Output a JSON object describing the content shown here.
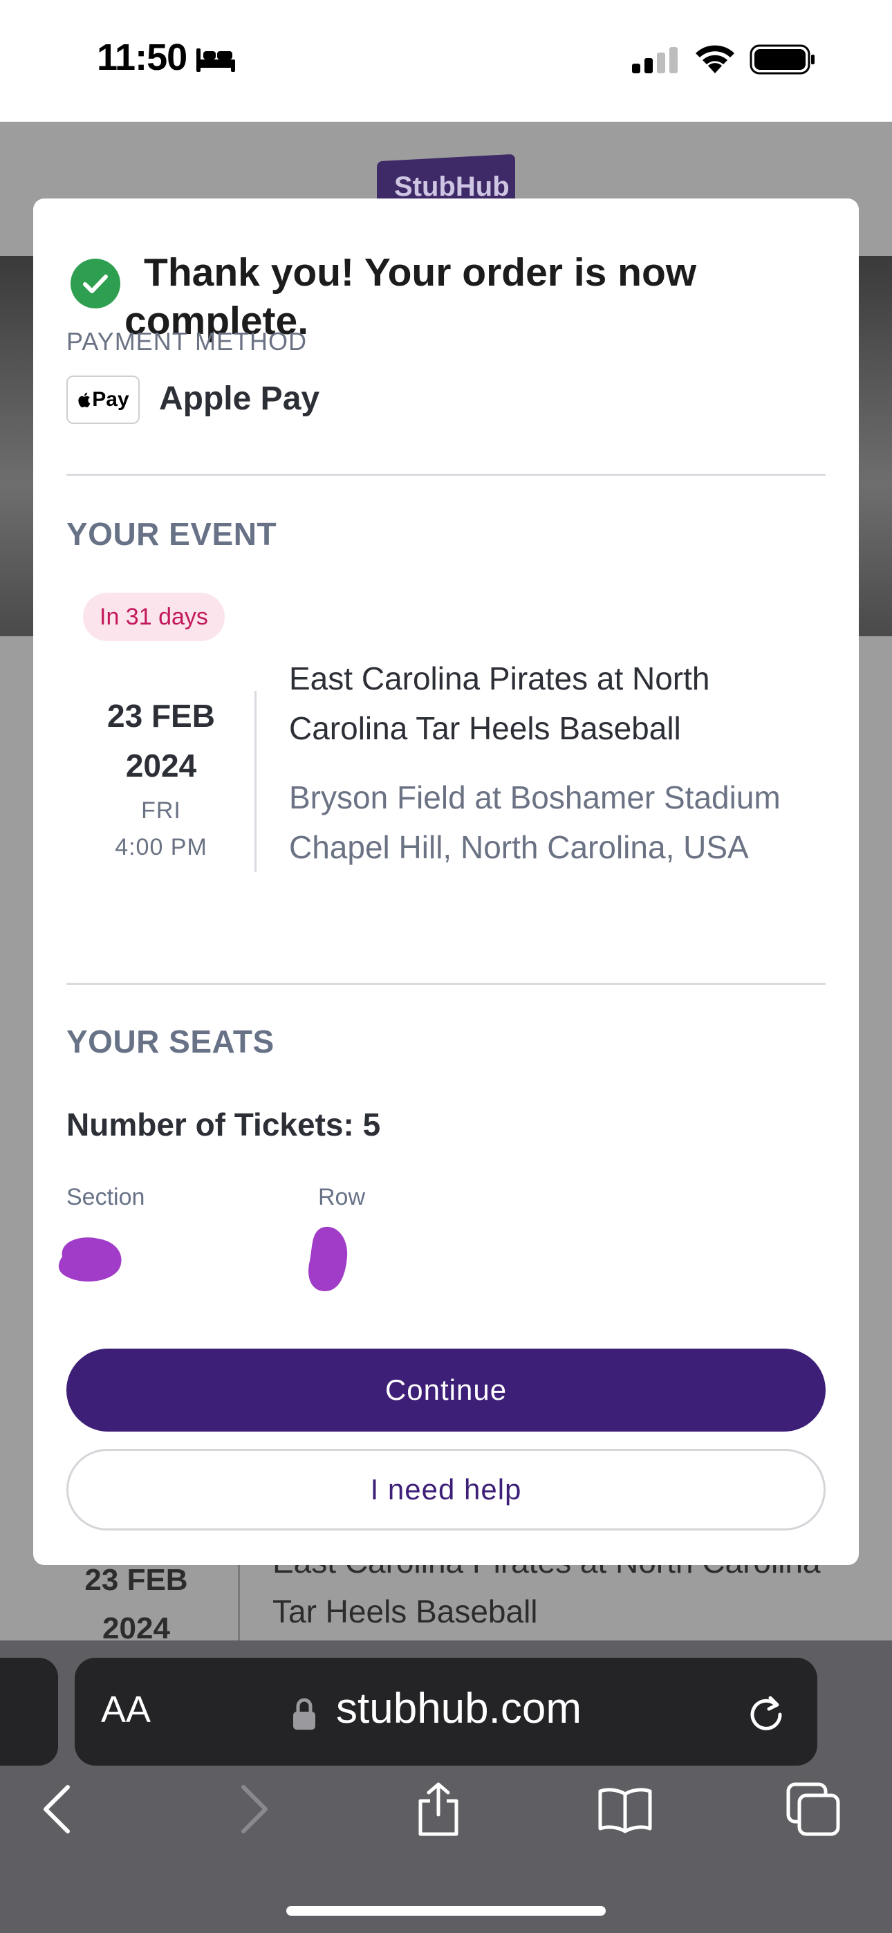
{
  "status_bar": {
    "time": "11:50",
    "icons": [
      "bed-icon",
      "cellular-signal-icon",
      "wifi-icon",
      "battery-icon"
    ]
  },
  "background_page": {
    "logo": "StubHub",
    "date_line1": "23 FEB",
    "date_line2": "2024",
    "event_title": "East Carolina Pirates at North Carolina Tar Heels Baseball"
  },
  "modal": {
    "title": "Thank you! Your order is now complete.",
    "payment": {
      "label": "PAYMENT METHOD",
      "badge": "Pay",
      "value": "Apple Pay"
    },
    "event": {
      "heading": "YOUR EVENT",
      "countdown": "In 31 days",
      "date_day_month": "23 FEB",
      "date_year": "2024",
      "day_of_week": "FRI",
      "time": "4:00 PM",
      "title": "East Carolina Pirates at North Carolina Tar Heels Baseball",
      "venue_line1": "Bryson Field at Boshamer Stadium",
      "venue_line2": "Chapel Hill, North Carolina, USA"
    },
    "seats": {
      "heading": "YOUR SEATS",
      "tickets": "Number of Tickets: 5",
      "section_label": "Section",
      "row_label": "Row"
    },
    "buttons": {
      "continue": "Continue",
      "help": "I need help"
    }
  },
  "safari": {
    "text_size_label": "AA",
    "url": "stubhub.com",
    "nav_icons": [
      "back-icon",
      "forward-icon",
      "share-icon",
      "bookmarks-icon",
      "tabs-icon"
    ]
  },
  "colors": {
    "brand_purple": "#3e1f78",
    "success_green": "#2e9e50",
    "countdown_pink": "#c2185b",
    "redaction_purple": "#a03cc8"
  }
}
